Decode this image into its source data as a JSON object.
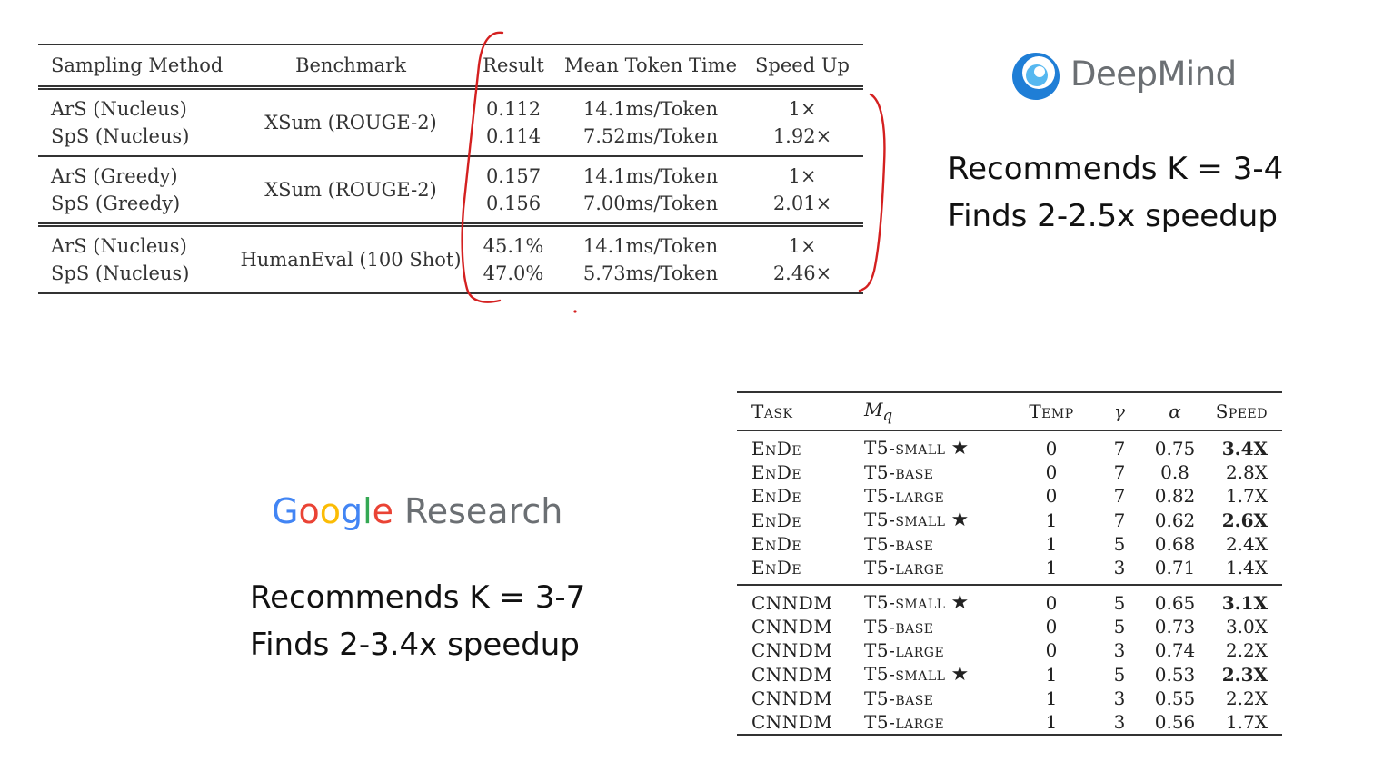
{
  "deepmind_table": {
    "headers": [
      "Sampling Method",
      "Benchmark",
      "Result",
      "Mean Token Time",
      "Speed Up"
    ],
    "groups": [
      {
        "benchmark": "XSum (ROUGE-2)",
        "rows": [
          {
            "method": "ArS (Nucleus)",
            "result": "0.112",
            "time": "14.1ms/Token",
            "speedup": "1×"
          },
          {
            "method": "SpS (Nucleus)",
            "result": "0.114",
            "time": "7.52ms/Token",
            "speedup": "1.92×"
          }
        ]
      },
      {
        "benchmark": "XSum (ROUGE-2)",
        "rows": [
          {
            "method": "ArS (Greedy)",
            "result": "0.157",
            "time": "14.1ms/Token",
            "speedup": "1×"
          },
          {
            "method": "SpS (Greedy)",
            "result": "0.156",
            "time": "7.00ms/Token",
            "speedup": "2.01×"
          }
        ]
      },
      {
        "benchmark": "HumanEval (100 Shot)",
        "rows": [
          {
            "method": "ArS (Nucleus)",
            "result": "45.1%",
            "time": "14.1ms/Token",
            "speedup": "1×"
          },
          {
            "method": "SpS (Nucleus)",
            "result": "47.0%",
            "time": "5.73ms/Token",
            "speedup": "2.46×"
          }
        ]
      }
    ]
  },
  "deepmind": {
    "brand": "DeepMind",
    "line1": "Recommends K = 3-4",
    "line2": "Finds 2-2.5x speedup"
  },
  "google": {
    "brand_letters": [
      "G",
      "o",
      "o",
      "g",
      "l",
      "e"
    ],
    "brand_colors": [
      "#4285F4",
      "#EA4335",
      "#FBBC05",
      "#4285F4",
      "#34A853",
      "#EA4335"
    ],
    "research": "Research",
    "line1": "Recommends K = 3-7",
    "line2": "Finds 2-3.4x speedup"
  },
  "google_table": {
    "headers": {
      "task": "Task",
      "mq_base": "M",
      "mq_sub": "q",
      "temp": "Temp",
      "gamma": "γ",
      "alpha": "α",
      "speed": "Speed"
    },
    "ende": [
      {
        "task": "EnDe",
        "model": "T5-small",
        "star": "★",
        "temp": "0",
        "gamma": "7",
        "alpha": "0.75",
        "speed": "3.4X",
        "bold": true
      },
      {
        "task": "EnDe",
        "model": "T5-base",
        "star": "",
        "temp": "0",
        "gamma": "7",
        "alpha": "0.8",
        "speed": "2.8X",
        "bold": false
      },
      {
        "task": "EnDe",
        "model": "T5-large",
        "star": "",
        "temp": "0",
        "gamma": "7",
        "alpha": "0.82",
        "speed": "1.7X",
        "bold": false
      },
      {
        "task": "EnDe",
        "model": "T5-small",
        "star": "★",
        "temp": "1",
        "gamma": "7",
        "alpha": "0.62",
        "speed": "2.6X",
        "bold": true
      },
      {
        "task": "EnDe",
        "model": "T5-base",
        "star": "",
        "temp": "1",
        "gamma": "5",
        "alpha": "0.68",
        "speed": "2.4X",
        "bold": false
      },
      {
        "task": "EnDe",
        "model": "T5-large",
        "star": "",
        "temp": "1",
        "gamma": "3",
        "alpha": "0.71",
        "speed": "1.4X",
        "bold": false
      }
    ],
    "cnndm": [
      {
        "task": "CNNDM",
        "model": "T5-small",
        "star": "★",
        "temp": "0",
        "gamma": "5",
        "alpha": "0.65",
        "speed": "3.1X",
        "bold": true
      },
      {
        "task": "CNNDM",
        "model": "T5-base",
        "star": "",
        "temp": "0",
        "gamma": "5",
        "alpha": "0.73",
        "speed": "3.0X",
        "bold": false
      },
      {
        "task": "CNNDM",
        "model": "T5-large",
        "star": "",
        "temp": "0",
        "gamma": "3",
        "alpha": "0.74",
        "speed": "2.2X",
        "bold": false
      },
      {
        "task": "CNNDM",
        "model": "T5-small",
        "star": "★",
        "temp": "1",
        "gamma": "5",
        "alpha": "0.53",
        "speed": "2.3X",
        "bold": true
      },
      {
        "task": "CNNDM",
        "model": "T5-base",
        "star": "",
        "temp": "1",
        "gamma": "3",
        "alpha": "0.55",
        "speed": "2.2X",
        "bold": false
      },
      {
        "task": "CNNDM",
        "model": "T5-large",
        "star": "",
        "temp": "1",
        "gamma": "3",
        "alpha": "0.56",
        "speed": "1.7X",
        "bold": false
      }
    ]
  },
  "colors": {
    "annotation_red": "#d42020",
    "deepmind_blue_dark": "#1f7ed6",
    "deepmind_blue_light": "#56b8f0",
    "brand_gray": "#6b6f73"
  }
}
